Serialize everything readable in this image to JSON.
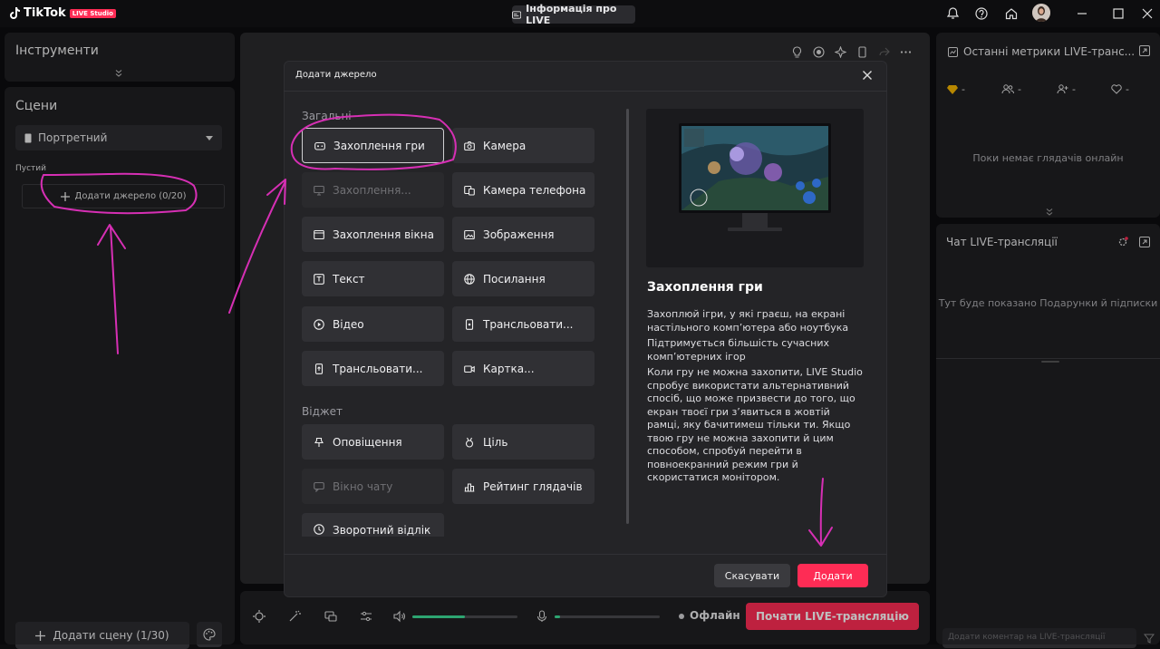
{
  "app": {
    "logo_text": "TikTok",
    "logo_badge": "LIVE Studio",
    "live_info_label": "Інформація про LIVE"
  },
  "left": {
    "tools_title": "Інструменти",
    "scenes_title": "Сцени",
    "scene_dropdown_value": "Портретний",
    "scene_empty_label": "Пустий",
    "add_source_label": "Додати джерело (0/20)",
    "add_scene_label": "Додати сцену (1/30)"
  },
  "bottom": {
    "status": "Офлайн",
    "start_label": "Почати LIVE-трансляцію",
    "volume_level": 0.5,
    "mic_level": 0.05
  },
  "right": {
    "metrics_title": "Останні метрики LIVE-транс...",
    "metrics": [
      {
        "icon": "diamond-icon",
        "value": "-"
      },
      {
        "icon": "viewers-icon",
        "value": "-"
      },
      {
        "icon": "new-follower-icon",
        "value": "-"
      },
      {
        "icon": "heart-icon",
        "value": "-"
      }
    ],
    "no_viewers": "Поки немає глядачів онлайн",
    "chat_title": "Чат LIVE-трансляції",
    "chat_empty": "Тут буде показано Подарунки й підписки",
    "chat_placeholder": "Додати коментар на LIVE-трансляції"
  },
  "modal": {
    "title": "Додати джерело",
    "group_general": "Загальні",
    "group_widget": "Віджет",
    "tiles": {
      "game_capture": "Захоплення гри",
      "camera": "Камера",
      "screen_capture": "Захоплення...",
      "phone_camera": "Камера телефона",
      "window_capture": "Захоплення вікна",
      "image": "Зображення",
      "text": "Текст",
      "link": "Посилання",
      "video": "Відео",
      "mobile_stream": "Трансльовати...",
      "stream_other": "Трансльовати...",
      "capture_card": "Картка...",
      "alerts": "Оповіщення",
      "goal": "Ціль",
      "chat_window": "Вікно чату",
      "viewer_rating": "Рейтинг глядачів",
      "countdown": "Зворотний відлік"
    },
    "preview_title": "Захоплення гри",
    "desc": [
      "Захоплюй ігри, у які граєш, на екрані настільного комп’ютера або ноутбука",
      "Підтримується більшість сучасних комп’ютерних ігор",
      "Коли гру не можна захопити, LIVE Studio спробує використати альтернативний спосіб, що може призвести до того, що екран твоєї гри з’явиться в жовтій рамці, яку бачитимеш тільки ти. Якщо твою гру не можна захопити й цим способом, спробуй перейти в повноекранний режим гри й скористатися монітором."
    ],
    "cancel_label": "Скасувати",
    "add_label": "Додати"
  },
  "colors": {
    "accent": "#fe2c55",
    "annotation": "#d62fb4",
    "level": "#3ddc97"
  }
}
